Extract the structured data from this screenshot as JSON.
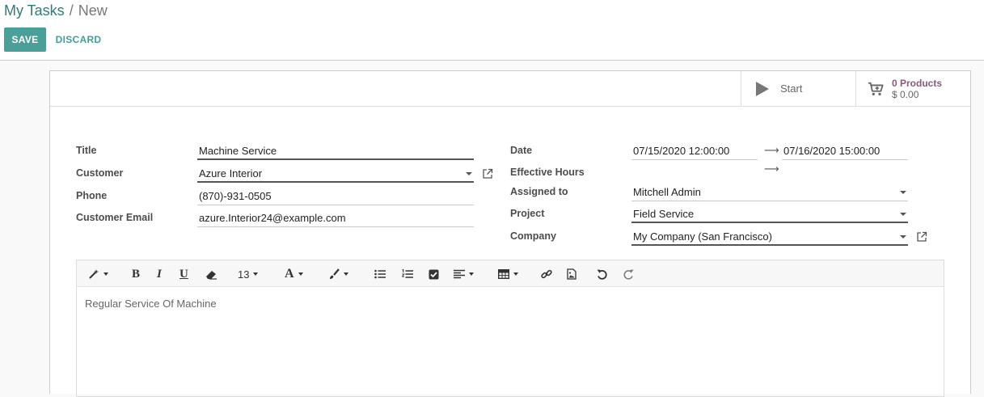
{
  "breadcrumb": {
    "parent": "My Tasks",
    "separator": "/",
    "current": "New"
  },
  "actions": {
    "save": "SAVE",
    "discard": "DISCARD"
  },
  "stat_buttons": {
    "start": {
      "label": "Start",
      "icon": "play-icon"
    },
    "products": {
      "value": "0 Products",
      "amount": "$ 0.00",
      "icon": "cart-plus-icon"
    }
  },
  "form": {
    "title": {
      "label": "Title",
      "value": "Machine Service"
    },
    "customer": {
      "label": "Customer",
      "value": "Azure Interior"
    },
    "phone": {
      "label": "Phone",
      "value": "(870)-931-0505"
    },
    "customer_email": {
      "label": "Customer Email",
      "value": "azure.Interior24@example.com"
    },
    "date": {
      "label": "Date",
      "start": "07/15/2020 12:00:00",
      "end": "07/16/2020 15:00:00"
    },
    "effective_hours": {
      "label": "Effective Hours"
    },
    "assigned_to": {
      "label": "Assigned to",
      "value": "Mitchell Admin"
    },
    "project": {
      "label": "Project",
      "value": "Field Service"
    },
    "company": {
      "label": "Company",
      "value": "My Company (San Francisco)"
    }
  },
  "editor": {
    "toolbar": {
      "font_size": "13",
      "bold": "B",
      "italic": "I",
      "underline": "U",
      "font_color": "A"
    },
    "content": "Regular Service Of Machine"
  },
  "colors": {
    "primary": "#4a9f98",
    "breadcrumb_link": "#2f7c78",
    "stat_value": "#875a7b"
  }
}
